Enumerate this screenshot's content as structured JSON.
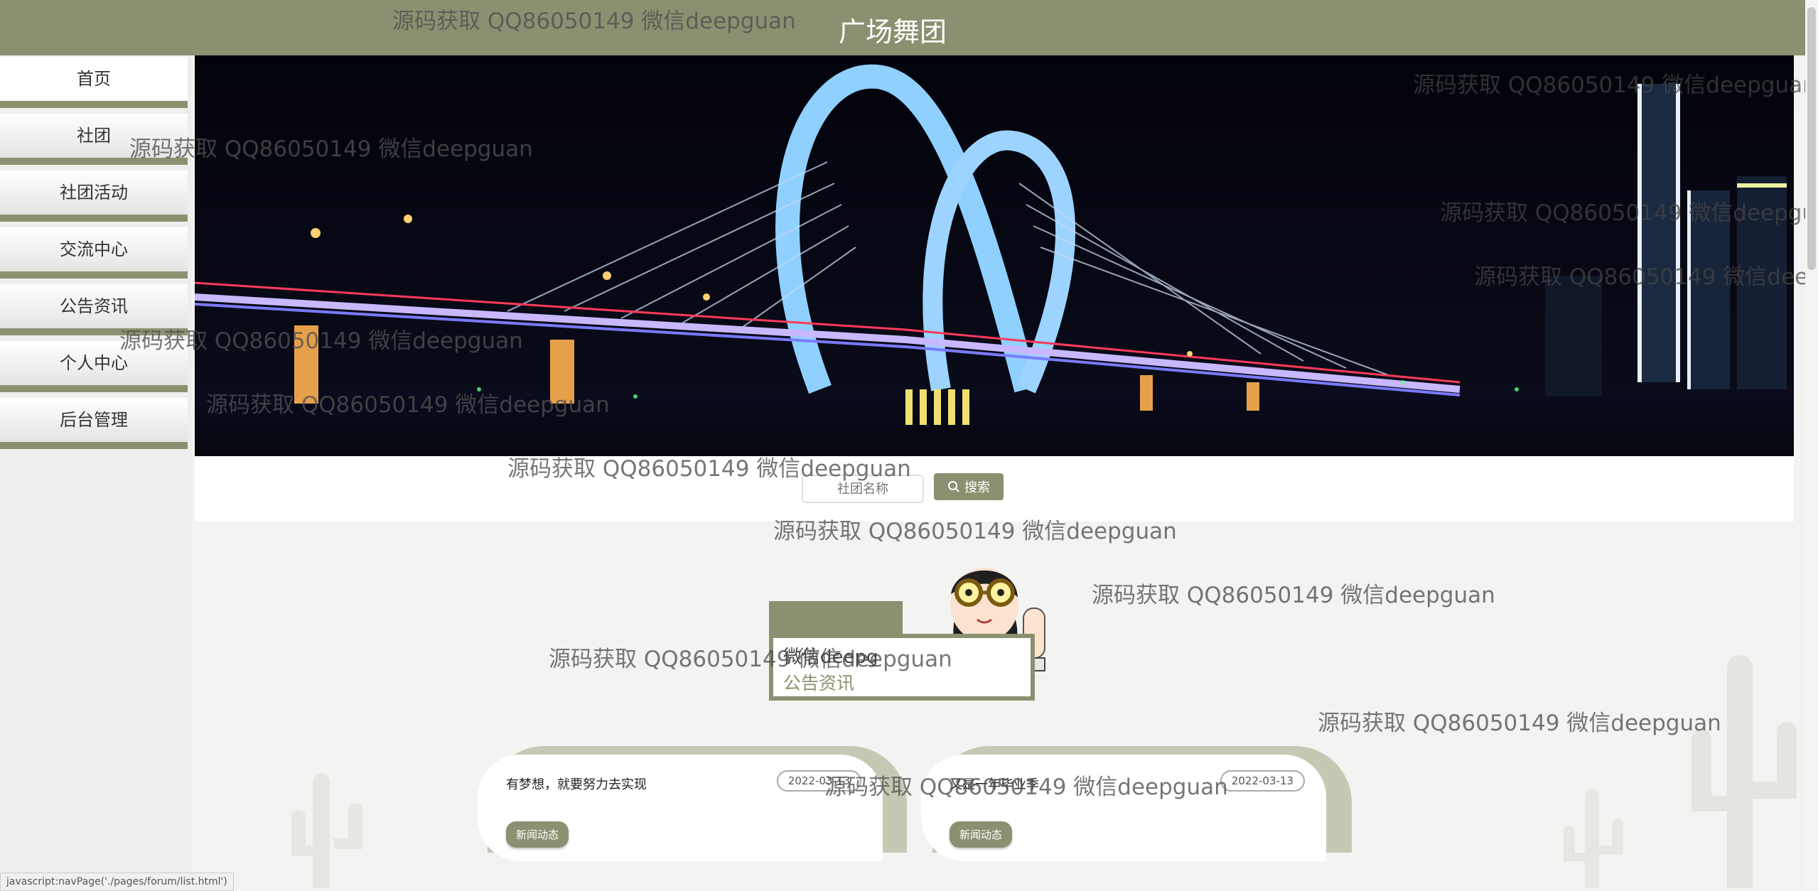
{
  "header": {
    "title": "广场舞团"
  },
  "sidebar": {
    "items": [
      {
        "label": "首页"
      },
      {
        "label": "社团"
      },
      {
        "label": "社团活动"
      },
      {
        "label": "交流中心"
      },
      {
        "label": "公告资讯"
      },
      {
        "label": "个人中心"
      },
      {
        "label": "后台管理"
      }
    ]
  },
  "banner": {
    "slides": 3,
    "active_slide": 1
  },
  "search": {
    "placeholder": "社团名称",
    "button_label": "搜索"
  },
  "section": {
    "garbled_text": "微信deepg",
    "title": "公告资讯"
  },
  "news": [
    {
      "title": "有梦想，就要努力去实现",
      "date": "2022-03-13",
      "tag": "新闻动态"
    },
    {
      "title": "又是一年毕业季",
      "date": "2022-03-13",
      "tag": "新闻动态"
    }
  ],
  "watermark": "源码获取 QQ86050149 微信deepguan",
  "statusbar": {
    "text": "javascript:navPage('./pages/forum/list.html')"
  },
  "colors": {
    "accent": "#8b9170",
    "card_arch": "#c6c8b4"
  },
  "icons": [
    "search-icon",
    "cartoon-girl-illustration",
    "cactus-decoration"
  ]
}
